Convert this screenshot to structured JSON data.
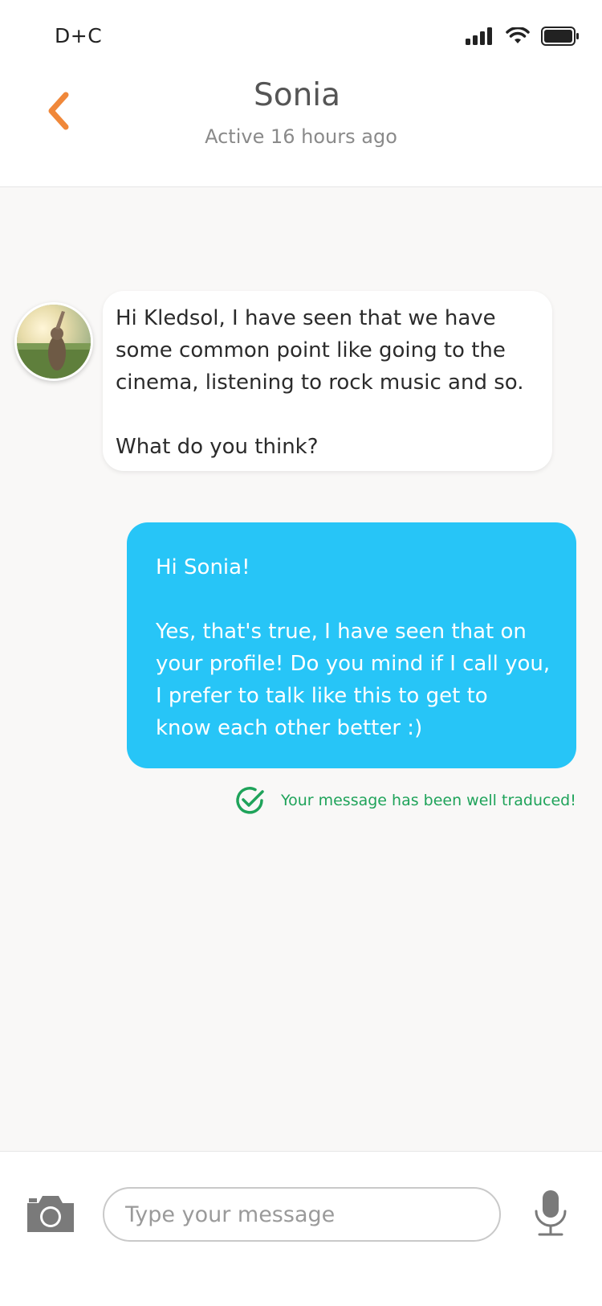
{
  "status_bar": {
    "carrier": "D+C"
  },
  "header": {
    "title": "Sonia",
    "subtitle": "Active 16 hours ago"
  },
  "messages": [
    {
      "direction": "incoming",
      "lines": [
        "Hi Kledsol, I have seen that we have",
        "some common point like going to the",
        "cinema, listening to rock music and so.",
        "What do you think?"
      ]
    },
    {
      "direction": "outgoing",
      "lines": [
        "Hi Sonia!",
        "Yes, that's true, I have seen that on",
        "your profile! Do you mind if I call you,",
        "I prefer to talk like this to get to",
        "know each other better :)"
      ]
    }
  ],
  "confirmation": {
    "text": "Your message has been well traduced!"
  },
  "composer": {
    "placeholder": "Type your message",
    "value": ""
  },
  "colors": {
    "accent_orange": "#f0883a",
    "outgoing_bubble": "#27c5f7",
    "success_green": "#1fa35a",
    "background": "#f9f8f7"
  },
  "icons": {
    "back": "chevron-left-icon",
    "camera": "camera-icon",
    "microphone": "microphone-icon",
    "check": "check-circle-icon"
  }
}
